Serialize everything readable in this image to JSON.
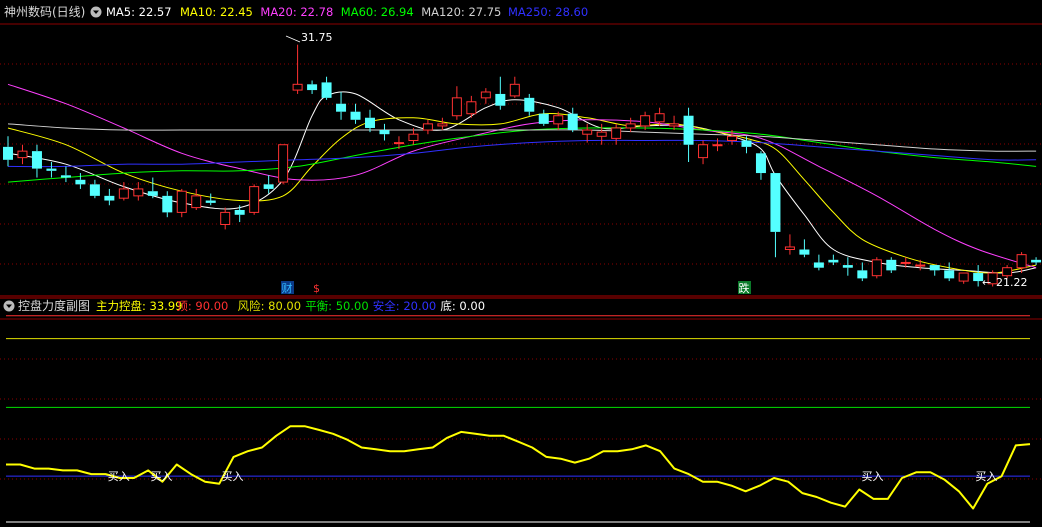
{
  "main_panel": {
    "title": "神州数码(日线)",
    "indicators": [
      {
        "label": "MA5: 22.57",
        "color": "#ffffff"
      },
      {
        "label": "MA10: 22.45",
        "color": "#ffff00"
      },
      {
        "label": "MA20: 22.78",
        "color": "#ff40ff"
      },
      {
        "label": "MA60: 26.94",
        "color": "#00ff00"
      },
      {
        "label": "MA120: 27.75",
        "color": "#d0d0d0"
      },
      {
        "label": "MA250: 28.60",
        "color": "#3030ff"
      }
    ],
    "high_marker": "31.75",
    "low_marker": "21.22",
    "event_markers": [
      {
        "text": "财",
        "color": "#33bbff",
        "bg": "#0a3a88"
      },
      {
        "text": "$",
        "color": "#ff3333",
        "bg": ""
      },
      {
        "text": "跌",
        "color": "#ffffff",
        "bg": "#0b7a2a"
      }
    ]
  },
  "sub_panel": {
    "title": "控盘力度副图",
    "indicators": [
      {
        "label": "主力控盘: 33.99",
        "color": "#ffff00"
      },
      {
        "label": "顶: 90.00",
        "color": "#ff3030"
      },
      {
        "label": "风险: 80.00",
        "color": "#e0e000"
      },
      {
        "label": "平衡: 50.00",
        "color": "#00e000"
      },
      {
        "label": "安全: 20.00",
        "color": "#3030ff"
      },
      {
        "label": "底: 0.00",
        "color": "#ffffff"
      }
    ],
    "buy_label": "买入"
  },
  "colors": {
    "up": "#ff3232",
    "down": "#54ffff",
    "grid": "#8b0000"
  },
  "chart_data": [
    {
      "type": "candlestick",
      "title": "神州数码(日线)",
      "y_scale": "log",
      "price_range": [
        20.5,
        32.7
      ],
      "candles_ohlc": [
        [
          26.5,
          27.0,
          25.6,
          25.9
        ],
        [
          26.0,
          26.6,
          25.7,
          26.3
        ],
        [
          26.3,
          26.6,
          25.1,
          25.5
        ],
        [
          25.5,
          25.8,
          25.1,
          25.4
        ],
        [
          25.2,
          25.6,
          24.9,
          25.1
        ],
        [
          25.0,
          25.3,
          24.6,
          24.8
        ],
        [
          24.8,
          25.0,
          24.2,
          24.3
        ],
        [
          24.3,
          24.6,
          23.9,
          24.1
        ],
        [
          24.2,
          24.9,
          24.1,
          24.6
        ],
        [
          24.3,
          24.9,
          24.1,
          24.6
        ],
        [
          24.5,
          25.1,
          24.2,
          24.3
        ],
        [
          24.3,
          24.5,
          23.4,
          23.6
        ],
        [
          23.6,
          24.6,
          23.4,
          24.5
        ],
        [
          23.8,
          24.6,
          23.7,
          24.3
        ],
        [
          24.1,
          24.4,
          23.9,
          24.0
        ],
        [
          23.1,
          23.8,
          22.9,
          23.6
        ],
        [
          23.7,
          23.9,
          23.2,
          23.5
        ],
        [
          23.6,
          24.8,
          23.5,
          24.7
        ],
        [
          24.8,
          25.2,
          24.4,
          24.6
        ],
        [
          24.9,
          26.6,
          24.8,
          26.6
        ],
        [
          29.3,
          31.75,
          29.1,
          29.6
        ],
        [
          29.6,
          29.8,
          29.1,
          29.3
        ],
        [
          29.7,
          30.0,
          28.8,
          28.9
        ],
        [
          28.6,
          29.2,
          27.8,
          28.2
        ],
        [
          28.2,
          28.6,
          27.6,
          27.8
        ],
        [
          27.9,
          28.3,
          27.2,
          27.4
        ],
        [
          27.3,
          27.6,
          26.8,
          27.1
        ],
        [
          26.7,
          27.0,
          26.4,
          26.7
        ],
        [
          26.8,
          27.4,
          26.6,
          27.1
        ],
        [
          27.3,
          27.8,
          27.1,
          27.6
        ],
        [
          27.5,
          27.9,
          27.3,
          27.6
        ],
        [
          28.0,
          29.5,
          27.8,
          28.9
        ],
        [
          28.1,
          29.0,
          27.9,
          28.7
        ],
        [
          28.9,
          29.4,
          28.6,
          29.2
        ],
        [
          29.1,
          30.0,
          28.3,
          28.5
        ],
        [
          29.0,
          30.0,
          28.9,
          29.6
        ],
        [
          28.9,
          29.1,
          28.0,
          28.2
        ],
        [
          28.1,
          28.3,
          27.5,
          27.6
        ],
        [
          27.6,
          28.2,
          27.3,
          28.0
        ],
        [
          28.1,
          28.4,
          27.2,
          27.3
        ],
        [
          27.1,
          27.6,
          26.7,
          27.3
        ],
        [
          27.0,
          27.6,
          26.6,
          27.2
        ],
        [
          26.9,
          27.6,
          26.6,
          27.4
        ],
        [
          27.4,
          27.9,
          27.2,
          27.6
        ],
        [
          27.5,
          28.2,
          27.3,
          28.0
        ],
        [
          27.7,
          28.4,
          27.5,
          28.1
        ],
        [
          27.5,
          28.0,
          27.3,
          27.6
        ],
        [
          28.0,
          28.4,
          25.8,
          26.6
        ],
        [
          26.0,
          26.8,
          25.7,
          26.6
        ],
        [
          26.6,
          26.9,
          26.3,
          26.6
        ],
        [
          26.8,
          27.3,
          26.6,
          27.0
        ],
        [
          26.8,
          27.0,
          26.2,
          26.5
        ],
        [
          26.2,
          26.3,
          25.0,
          25.3
        ],
        [
          25.3,
          25.3,
          21.8,
          22.8
        ],
        [
          22.1,
          22.7,
          21.9,
          22.2
        ],
        [
          22.1,
          22.5,
          21.8,
          21.9
        ],
        [
          21.6,
          21.9,
          21.3,
          21.4
        ],
        [
          21.7,
          21.9,
          21.5,
          21.6
        ],
        [
          21.5,
          21.8,
          21.1,
          21.4
        ],
        [
          21.3,
          21.6,
          20.9,
          21.0
        ],
        [
          21.1,
          21.8,
          21.0,
          21.7
        ],
        [
          21.7,
          21.8,
          21.2,
          21.3
        ],
        [
          21.6,
          21.8,
          21.4,
          21.6
        ],
        [
          21.5,
          21.7,
          21.3,
          21.5
        ],
        [
          21.5,
          21.5,
          21.1,
          21.3
        ],
        [
          21.3,
          21.6,
          20.9,
          21.0
        ],
        [
          20.9,
          21.2,
          20.8,
          21.2
        ],
        [
          21.2,
          21.5,
          20.7,
          20.9
        ],
        [
          20.8,
          21.3,
          20.7,
          21.2
        ],
        [
          21.1,
          21.5,
          21.0,
          21.4
        ],
        [
          21.4,
          22.0,
          21.2,
          21.9
        ],
        [
          21.7,
          21.8,
          21.5,
          21.6
        ]
      ],
      "series": [
        {
          "name": "MA5",
          "color": "#ffffff",
          "x": [
            0,
            4,
            8,
            12,
            16,
            19,
            21,
            22,
            24,
            27,
            30,
            33,
            35,
            38,
            41,
            44,
            47,
            50,
            52,
            53,
            55,
            57,
            60,
            63,
            66,
            69,
            71
          ],
          "values": [
            26.2,
            25.7,
            24.7,
            24.0,
            23.8,
            25.0,
            28.0,
            29.0,
            29.1,
            27.8,
            27.3,
            28.4,
            28.8,
            28.4,
            27.4,
            27.5,
            27.5,
            27.0,
            26.4,
            25.2,
            23.5,
            22.1,
            21.6,
            21.4,
            21.3,
            21.2,
            21.4
          ]
        },
        {
          "name": "MA10",
          "color": "#ffff00",
          "x": [
            0,
            4,
            8,
            12,
            16,
            19,
            21,
            23,
            25,
            28,
            31,
            34,
            37,
            40,
            43,
            46,
            49,
            51,
            53,
            55,
            57,
            59,
            62,
            65,
            68,
            71
          ],
          "values": [
            27.4,
            26.6,
            25.3,
            24.5,
            24.1,
            24.3,
            25.6,
            26.9,
            27.7,
            27.9,
            27.6,
            27.6,
            28.1,
            27.9,
            27.5,
            27.6,
            27.2,
            26.9,
            26.4,
            25.0,
            23.6,
            22.5,
            21.8,
            21.4,
            21.2,
            21.5
          ]
        },
        {
          "name": "MA20",
          "color": "#ff40ff",
          "x": [
            0,
            4,
            8,
            12,
            16,
            20,
            24,
            28,
            32,
            36,
            40,
            44,
            48,
            52,
            56,
            60,
            64,
            67,
            71
          ],
          "values": [
            29.6,
            28.6,
            27.4,
            26.2,
            25.5,
            25.0,
            25.2,
            26.3,
            27.0,
            27.6,
            27.8,
            27.7,
            27.3,
            26.9,
            25.6,
            24.3,
            22.9,
            22.1,
            21.4
          ]
        },
        {
          "name": "MA60",
          "color": "#00ff00",
          "x": [
            0,
            4,
            8,
            12,
            16,
            20,
            24,
            28,
            32,
            36,
            40,
            44,
            48,
            52,
            56,
            60,
            64,
            68,
            71
          ],
          "values": [
            24.9,
            25.1,
            25.3,
            25.4,
            25.4,
            25.6,
            26.1,
            26.6,
            27.0,
            27.3,
            27.4,
            27.4,
            27.3,
            27.1,
            26.7,
            26.3,
            26.0,
            25.8,
            25.6
          ]
        },
        {
          "name": "MA120",
          "color": "#d0d0d0",
          "x": [
            0,
            4,
            8,
            12,
            16,
            20,
            24,
            28,
            32,
            36,
            40,
            44,
            48,
            52,
            56,
            60,
            64,
            68,
            71
          ],
          "values": [
            27.6,
            27.4,
            27.3,
            27.3,
            27.3,
            27.3,
            27.3,
            27.3,
            27.3,
            27.3,
            27.3,
            27.2,
            27.1,
            27.0,
            26.8,
            26.6,
            26.4,
            26.3,
            26.3
          ]
        },
        {
          "name": "MA250",
          "color": "#3030ff",
          "x": [
            0,
            4,
            8,
            12,
            16,
            20,
            24,
            28,
            32,
            36,
            40,
            44,
            48,
            52,
            56,
            60,
            64,
            68,
            71
          ],
          "values": [
            25.6,
            25.6,
            25.7,
            25.7,
            25.8,
            25.9,
            26.0,
            26.2,
            26.5,
            26.7,
            26.8,
            26.8,
            26.8,
            26.7,
            26.5,
            26.3,
            26.1,
            25.9,
            25.9
          ]
        }
      ]
    },
    {
      "type": "line",
      "title": "控盘力度副图",
      "ylim": [
        0,
        100
      ],
      "reference_lines": [
        {
          "name": "顶",
          "value": 90,
          "color": "#ff3030"
        },
        {
          "name": "风险",
          "value": 80,
          "color": "#e0e000"
        },
        {
          "name": "平衡",
          "value": 50,
          "color": "#00e000"
        },
        {
          "name": "安全",
          "value": 20,
          "color": "#3030ff"
        },
        {
          "name": "底",
          "value": 0,
          "color": "#ffffff"
        }
      ],
      "series": [
        {
          "name": "主力控盘",
          "color": "#ffff00",
          "values": [
            25.1,
            25.1,
            23.3,
            23.3,
            22.5,
            22.5,
            20.9,
            20.9,
            19.2,
            19.2,
            22.5,
            17.6,
            25.1,
            20.9,
            17.6,
            16.7,
            28.4,
            30.9,
            32.5,
            37.6,
            41.8,
            41.8,
            40.2,
            38.5,
            35.9,
            32.5,
            31.7,
            30.9,
            30.9,
            31.7,
            32.5,
            36.7,
            39.3,
            38.5,
            37.6,
            37.6,
            35.1,
            32.5,
            28.4,
            27.6,
            25.9,
            27.6,
            30.9,
            30.9,
            31.7,
            33.4,
            30.9,
            23.3,
            20.9,
            17.6,
            17.6,
            15.9,
            13.4,
            15.9,
            19.2,
            17.6,
            12.6,
            10.9,
            8.4,
            6.7,
            14.2,
            10.1,
            10.1,
            19.2,
            21.7,
            21.7,
            18.4,
            13.4,
            5.9,
            16.7,
            20.0,
            33.4,
            33.99
          ]
        }
      ],
      "buy_signals_x": [
        8,
        11,
        16,
        61,
        69
      ]
    }
  ]
}
